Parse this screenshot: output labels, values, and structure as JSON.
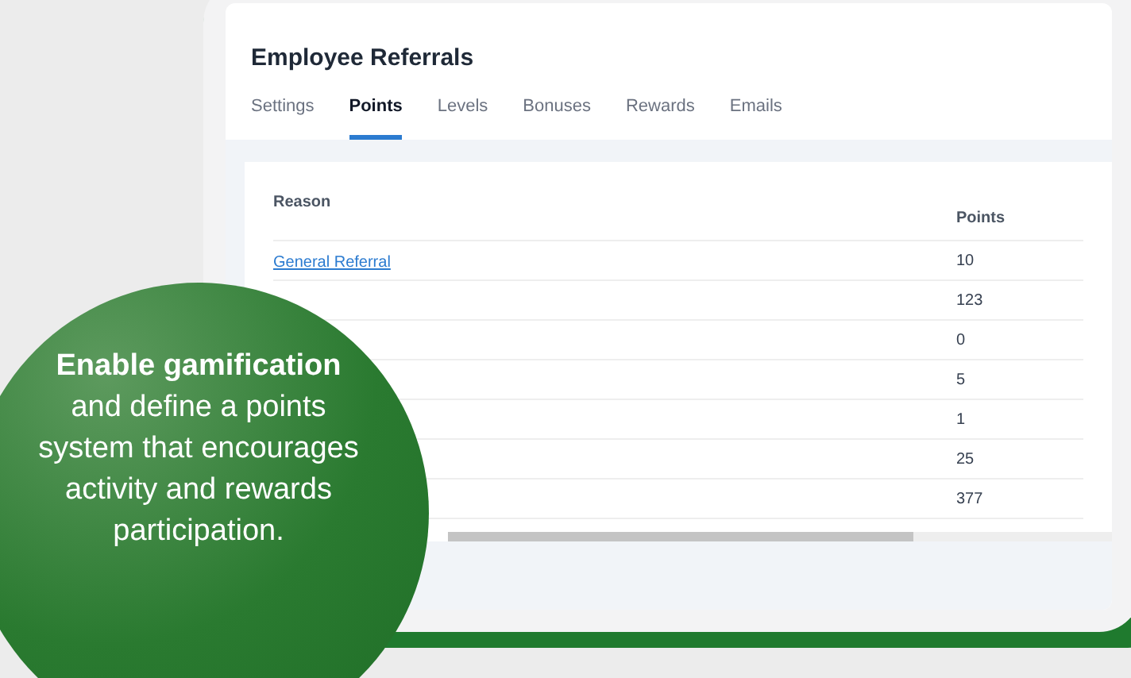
{
  "title": "Employee Referrals",
  "tabs": [
    {
      "label": "Settings",
      "selected": false
    },
    {
      "label": "Points",
      "selected": true
    },
    {
      "label": "Levels",
      "selected": false
    },
    {
      "label": "Bonuses",
      "selected": false
    },
    {
      "label": "Rewards",
      "selected": false
    },
    {
      "label": "Emails",
      "selected": false
    }
  ],
  "table": {
    "columns": [
      "Reason",
      "Points"
    ],
    "rows": [
      {
        "reason": "General Referral",
        "points": "10"
      },
      {
        "points": "123"
      },
      {
        "points": "0"
      },
      {
        "points": "5"
      },
      {
        "points": "1"
      },
      {
        "points": "25"
      },
      {
        "points": "377"
      }
    ]
  },
  "callout": {
    "text": "**Enable gamification** and define a points system that encourages activity and rewards participation."
  }
}
